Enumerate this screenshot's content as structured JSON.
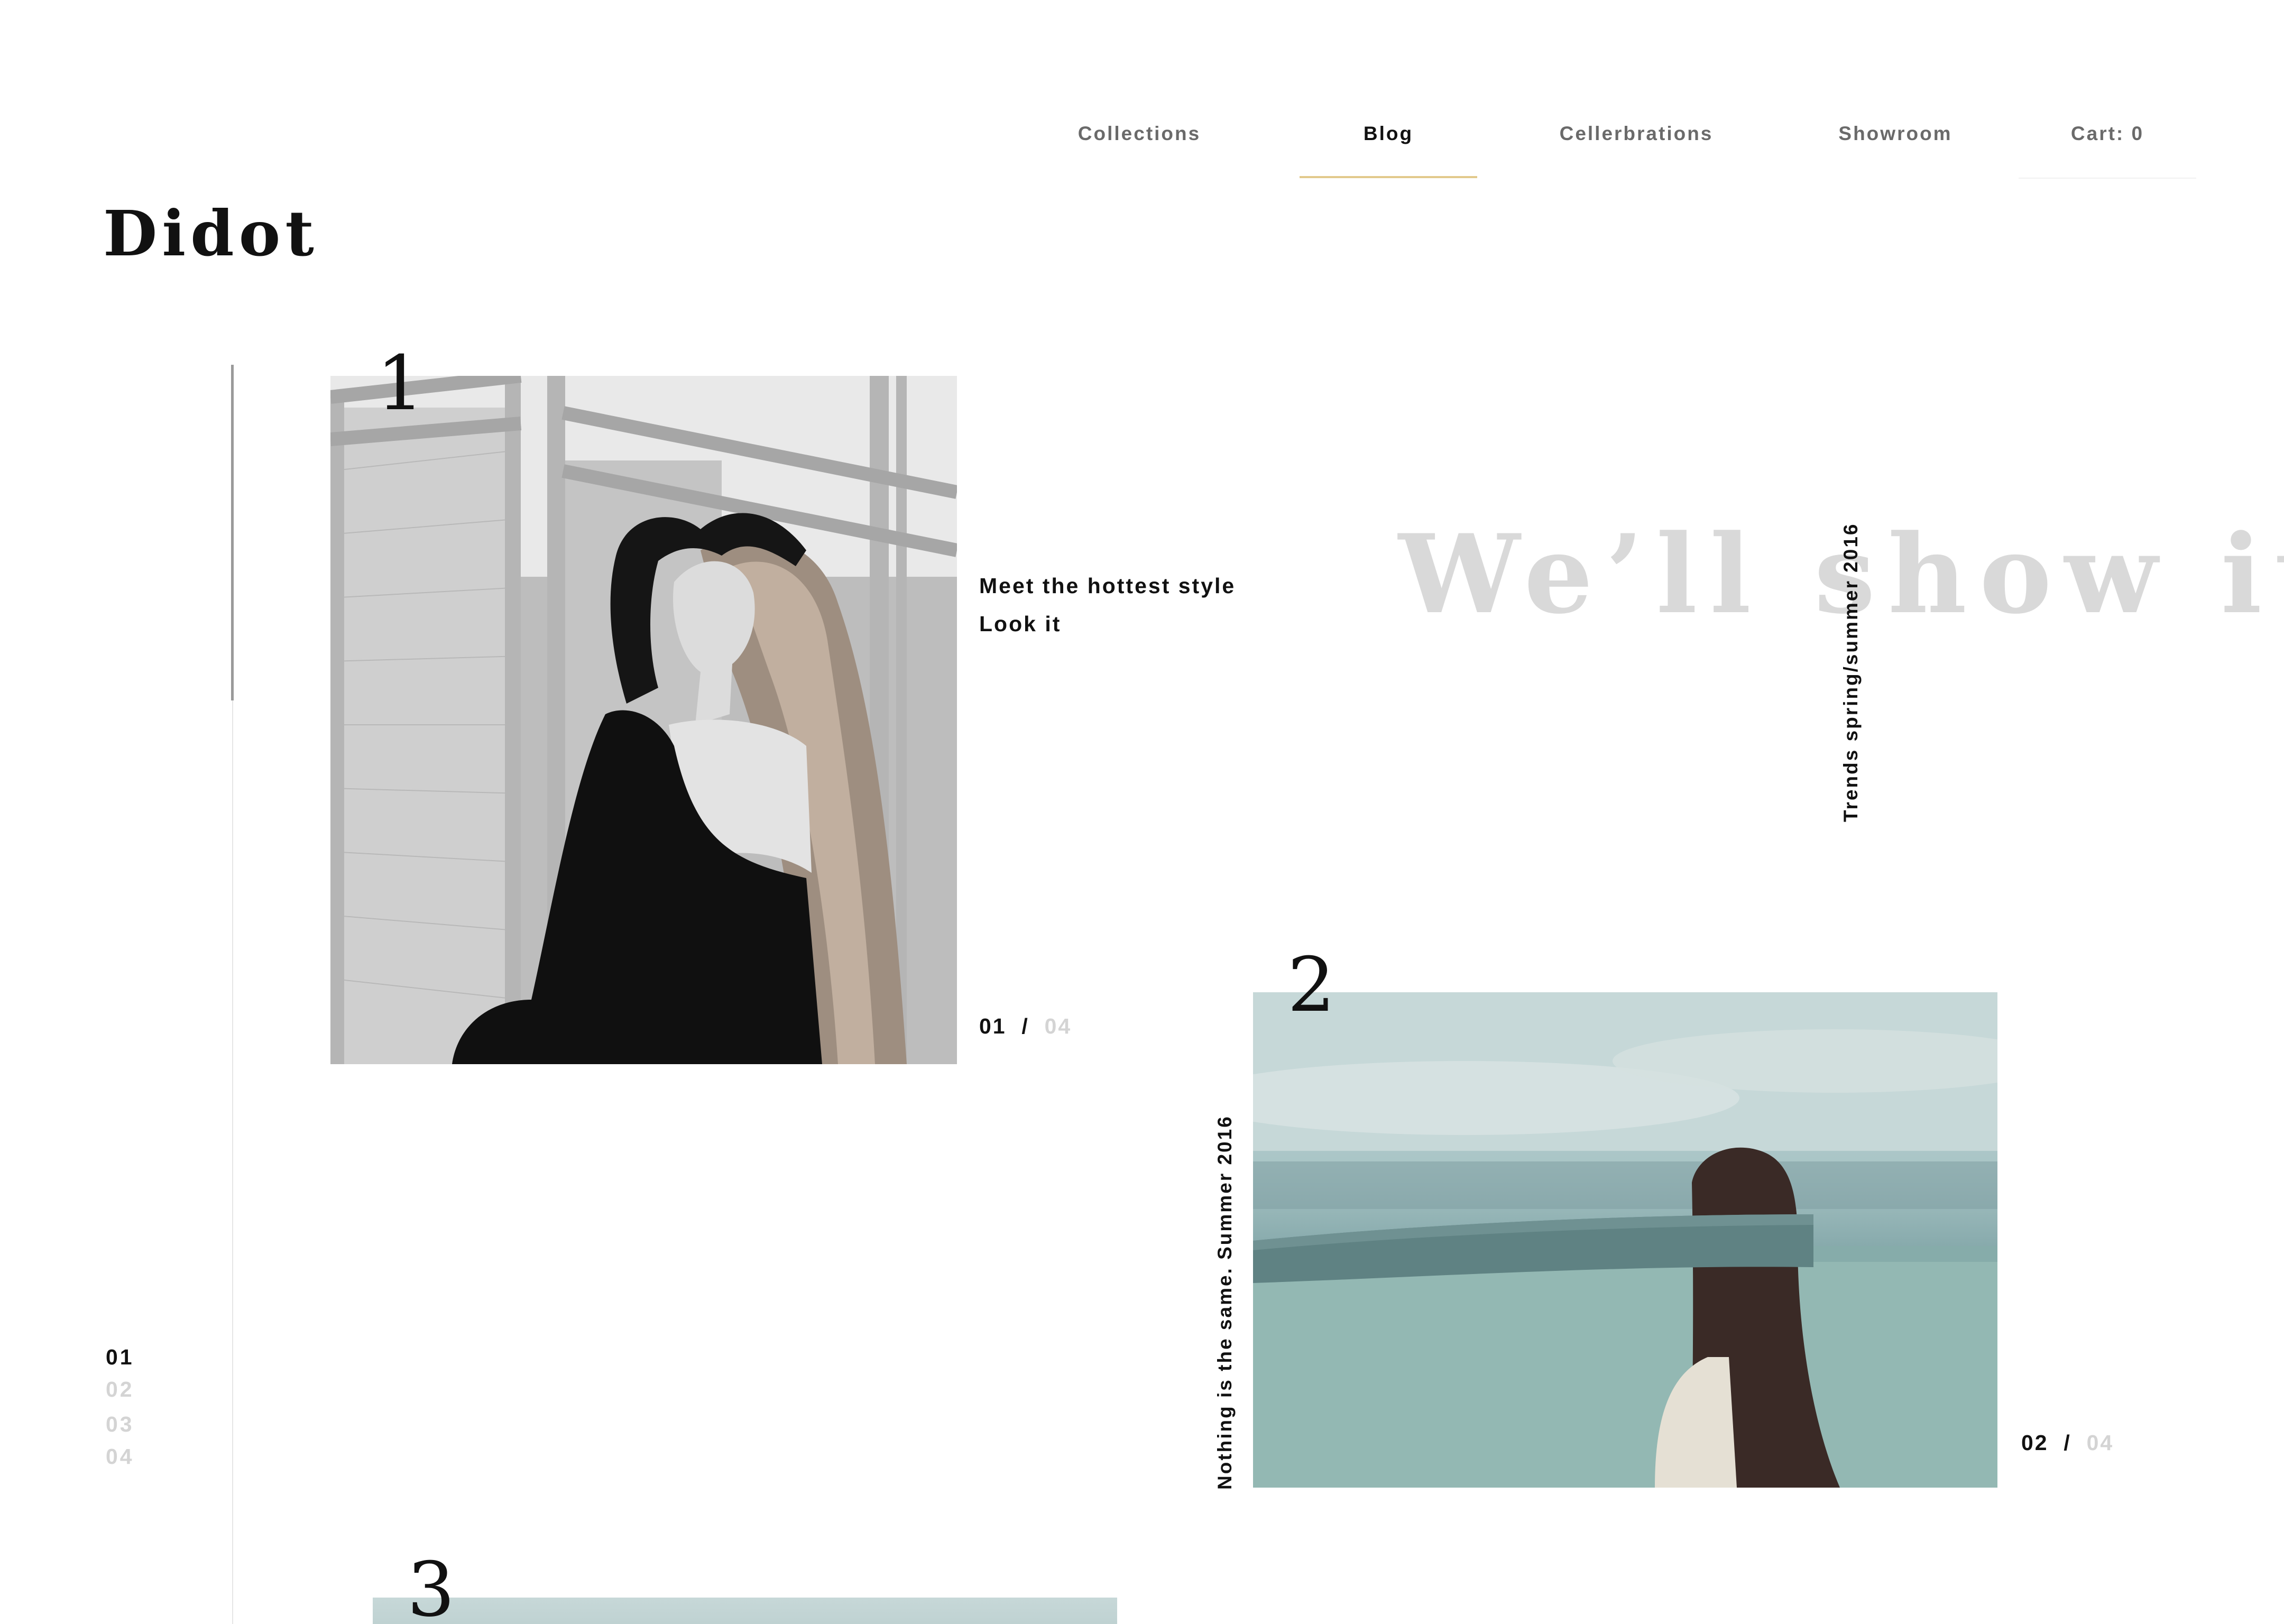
{
  "nav": {
    "items": [
      {
        "label": "Collections"
      },
      {
        "label": "Blog"
      },
      {
        "label": "Cellerbrations"
      },
      {
        "label": "Showroom"
      },
      {
        "label": "Cart: 0"
      }
    ],
    "active_index": 1,
    "accent_color": "#e2c98c"
  },
  "logo": {
    "text": "Didot"
  },
  "pager": {
    "items": [
      "01",
      "02",
      "03",
      "04"
    ],
    "current": "01"
  },
  "slides": [
    {
      "number": "1",
      "tagline_line1": "Meet the hottest style",
      "tagline_line2": "Look it",
      "counter_current": "01",
      "counter_sep": "/",
      "counter_total": "04"
    },
    {
      "number": "2",
      "vertical_caption": "Nothing is the same. Summer 2016",
      "counter_current": "02",
      "counter_sep": "/",
      "counter_total": "04"
    },
    {
      "number": "3"
    }
  ],
  "hero": {
    "headline": "We’ll show it",
    "vertical_caption": "Trends spring/summer 2016"
  }
}
